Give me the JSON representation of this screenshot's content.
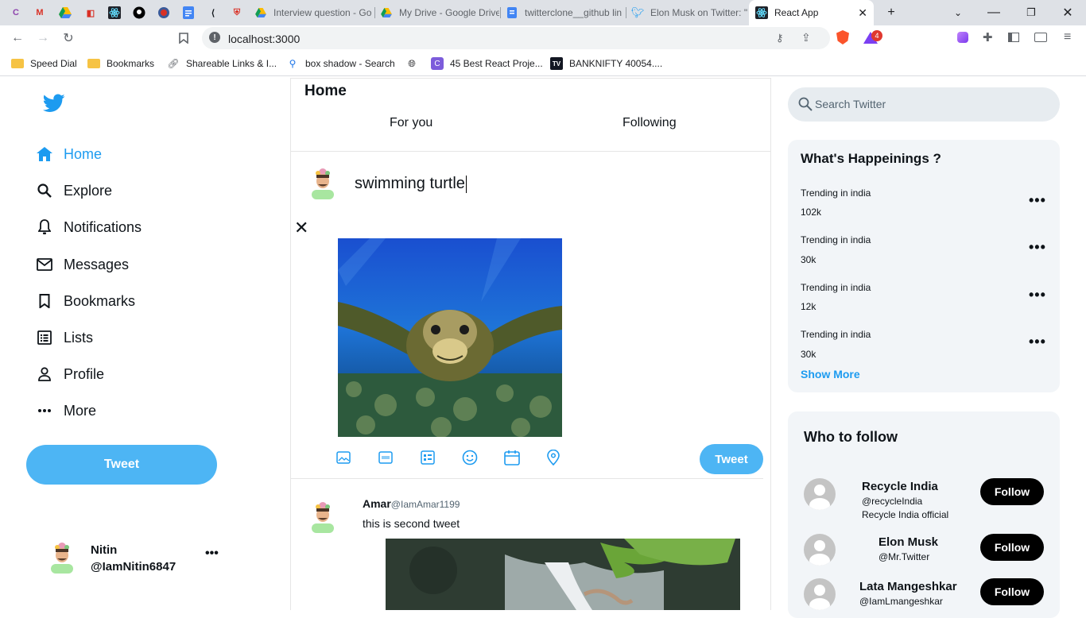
{
  "browser": {
    "tabs": [
      {
        "label": "Interview question - Go",
        "icon": "drive-icon"
      },
      {
        "label": "My Drive - Google Drive",
        "icon": "drive-icon"
      },
      {
        "label": "twitterclone__github lin",
        "icon": "docs-icon"
      },
      {
        "label": "Elon Musk on Twitter: \"",
        "icon": "twitter-icon"
      },
      {
        "label": "React App",
        "icon": "react-icon",
        "active": true
      }
    ],
    "url": "localhost:3000",
    "notification_count": "4",
    "bookmarks": [
      {
        "label": "Speed Dial",
        "icon": "folder-icon"
      },
      {
        "label": "Bookmarks",
        "icon": "folder-icon"
      },
      {
        "label": "Shareable Links & I...",
        "icon": "link-icon"
      },
      {
        "label": "box shadow - Search",
        "icon": "search-icon"
      },
      {
        "label": "",
        "icon": "globe-icon"
      },
      {
        "label": "45 Best React Proje...",
        "icon": "c-icon"
      },
      {
        "label": "BANKNIFTY 40054....",
        "icon": "tv-icon"
      }
    ]
  },
  "sidebar": {
    "items": [
      {
        "label": "Home",
        "icon": "home-icon",
        "active": true
      },
      {
        "label": "Explore",
        "icon": "search-icon"
      },
      {
        "label": "Notifications",
        "icon": "bell-icon"
      },
      {
        "label": "Messages",
        "icon": "mail-icon"
      },
      {
        "label": "Bookmarks",
        "icon": "bookmark-icon"
      },
      {
        "label": "Lists",
        "icon": "list-icon"
      },
      {
        "label": "Profile",
        "icon": "person-icon"
      },
      {
        "label": "More",
        "icon": "more-icon"
      }
    ],
    "tweet_button": "Tweet",
    "profile": {
      "name": "Nitin",
      "handle": "@IamNitin6847",
      "menu": "•••"
    }
  },
  "main": {
    "title": "Home",
    "tabs": [
      "For you",
      "Following"
    ],
    "compose": {
      "text": "swimming turtle",
      "tweet_button": "Tweet"
    },
    "post": {
      "name": "Amar",
      "handle": "@IamAmar1199",
      "text": "this is second tweet"
    }
  },
  "right": {
    "search_placeholder": "Search Twitter",
    "happenings": {
      "title": "What's Happeinings ?",
      "trends": [
        {
          "label": "Trending in india",
          "count": "102k"
        },
        {
          "label": "Trending in india",
          "count": "30k"
        },
        {
          "label": "Trending in india",
          "count": "12k"
        },
        {
          "label": "Trending in india",
          "count": "30k"
        }
      ],
      "more_icon": "•••",
      "show_more": "Show More"
    },
    "who_to_follow": {
      "title": "Who to follow",
      "users": [
        {
          "name": "Recycle India",
          "handle": "@recycleIndia",
          "bio": "Recycle India official"
        },
        {
          "name": "Elon Musk",
          "handle": "@Mr.Twitter",
          "bio": ""
        },
        {
          "name": "Lata Mangeshkar",
          "handle": "@IamLmangeshkar",
          "bio": ""
        }
      ],
      "follow_label": "Follow"
    }
  },
  "colors": {
    "accent": "#1d9bf0",
    "button": "#4db5f4",
    "card": "#f2f5f8"
  }
}
